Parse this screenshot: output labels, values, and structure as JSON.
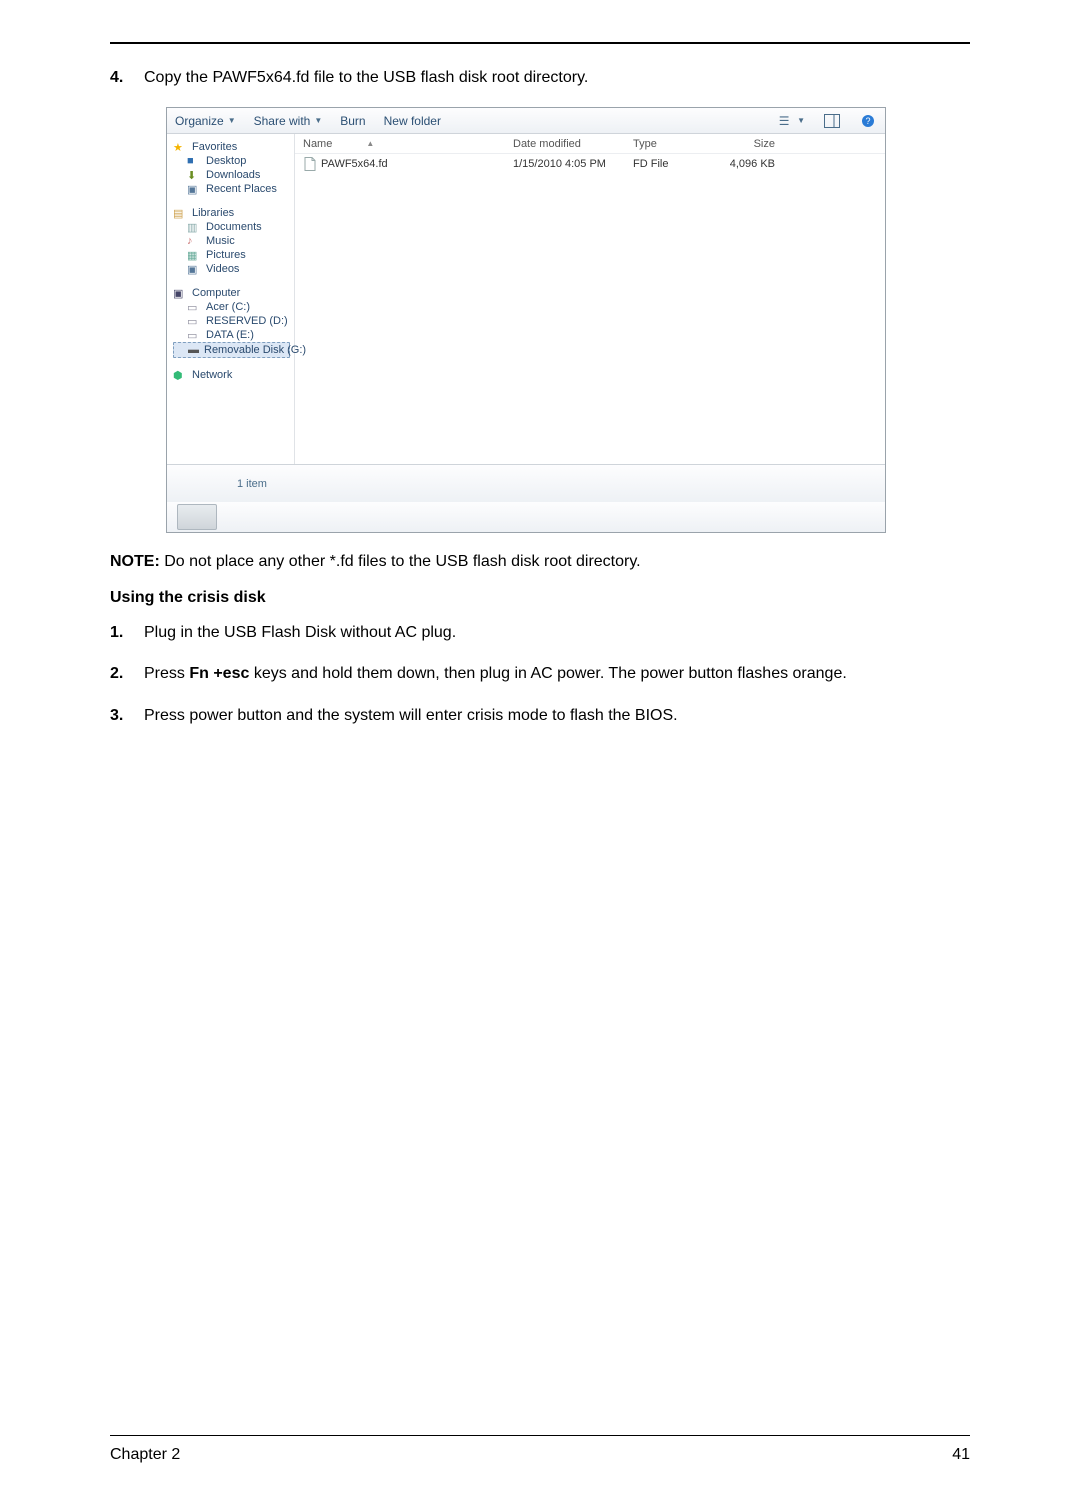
{
  "step4": {
    "num": "4.",
    "text": "Copy the PAWF5x64.fd file to the USB flash disk root directory."
  },
  "explorer": {
    "toolbar": {
      "organize": "Organize",
      "share": "Share with",
      "burn": "Burn",
      "new_folder": "New folder"
    },
    "columns": {
      "name": "Name",
      "date": "Date modified",
      "type": "Type",
      "size": "Size"
    },
    "file": {
      "name": "PAWF5x64.fd",
      "date": "1/15/2010 4:05 PM",
      "type": "FD File",
      "size": "4,096 KB"
    },
    "sidebar": {
      "favorites": "Favorites",
      "desktop": "Desktop",
      "downloads": "Downloads",
      "recent": "Recent Places",
      "libraries": "Libraries",
      "documents": "Documents",
      "music": "Music",
      "pictures": "Pictures",
      "videos": "Videos",
      "computer": "Computer",
      "acer": "Acer (C:)",
      "reserved": "RESERVED (D:)",
      "data": "DATA (E:)",
      "removable": "Removable Disk (G:)",
      "network": "Network"
    },
    "status": "1 item"
  },
  "note": {
    "label": "NOTE:",
    "text": " Do not place any other *.fd files to the USB flash disk root directory."
  },
  "subhead": "Using the crisis disk",
  "steps": {
    "1": {
      "num": "1.",
      "text": "Plug in the USB Flash Disk without AC plug."
    },
    "2": {
      "num": "2.",
      "pre": "Press ",
      "key": "Fn +esc",
      "post": " keys and hold them down, then plug in AC power. The power button flashes orange."
    },
    "3": {
      "num": "3.",
      "text": "Press power button and the system will enter crisis mode to flash the BIOS."
    }
  },
  "footer": {
    "chapter": "Chapter 2",
    "page": "41"
  }
}
